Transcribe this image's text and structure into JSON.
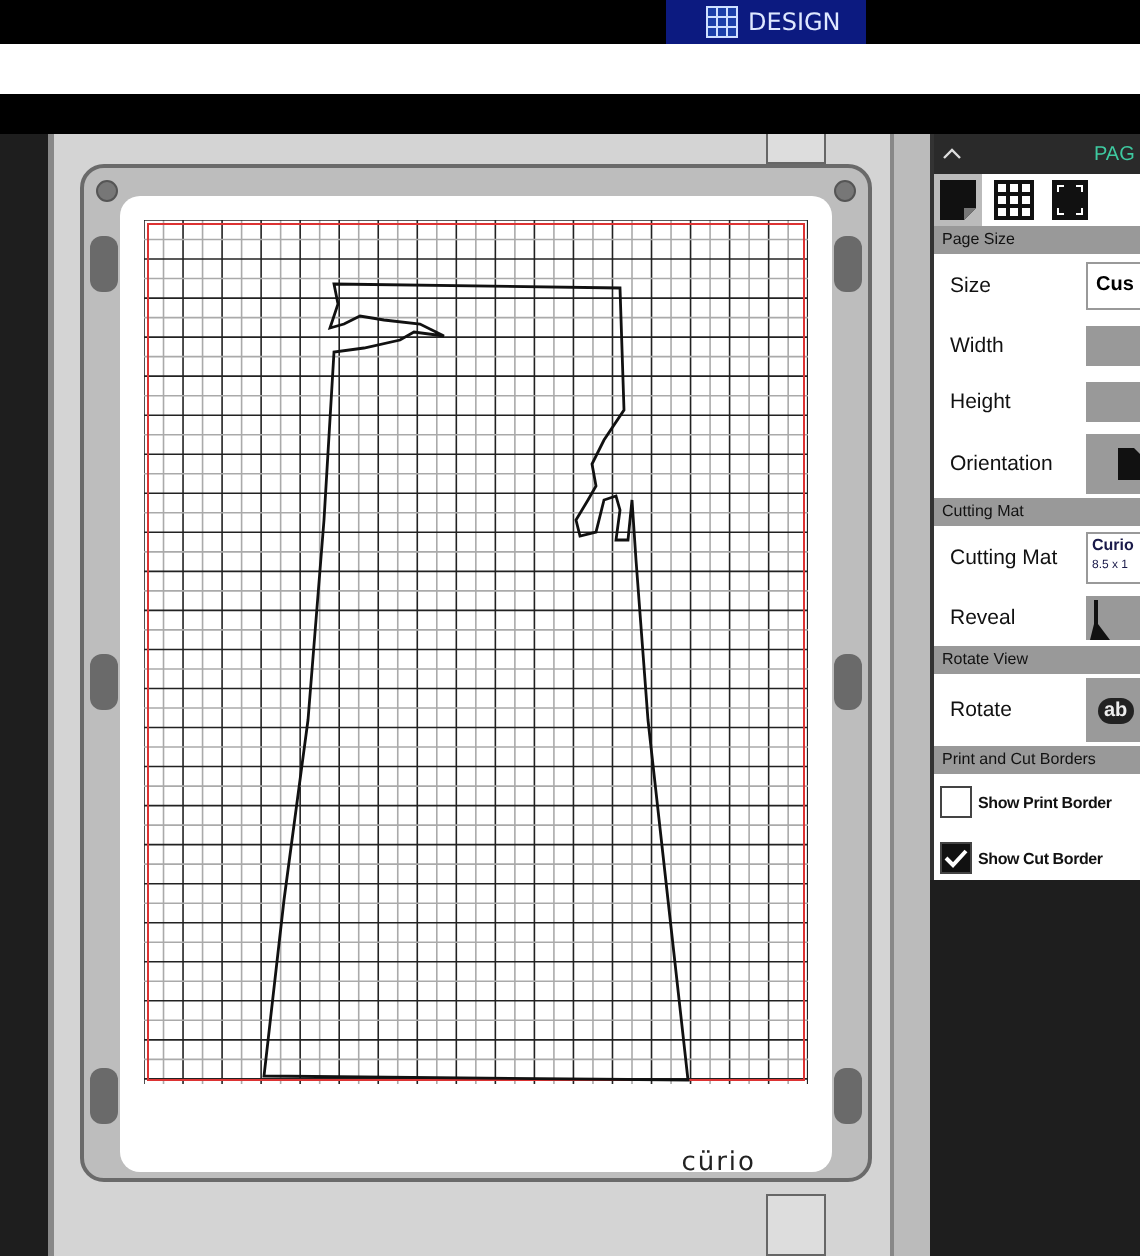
{
  "top_bar": {
    "tabs": [
      {
        "label": "DESIGN",
        "selected": true
      }
    ]
  },
  "canvas": {
    "mat": {
      "brand": "cürio"
    }
  },
  "panel": {
    "title": "PAG",
    "view_tabs": [
      {
        "kind": "page",
        "selected": true
      },
      {
        "kind": "grid",
        "selected": false
      },
      {
        "kind": "corners",
        "selected": false
      }
    ],
    "sections": [
      {
        "title": "Page Size",
        "rows": [
          {
            "kind": "select",
            "label": "Size",
            "value": "Cus"
          },
          {
            "kind": "input",
            "label": "Width"
          },
          {
            "kind": "input",
            "label": "Height"
          },
          {
            "kind": "orientation",
            "label": "Orientation"
          }
        ]
      },
      {
        "title": "Cutting Mat",
        "rows": [
          {
            "kind": "mat",
            "label": "Cutting Mat",
            "value": "Curio",
            "subvalue": "8.5 x 1"
          },
          {
            "kind": "reveal",
            "label": "Reveal"
          }
        ]
      },
      {
        "title": "Rotate View",
        "rows": [
          {
            "kind": "rotate",
            "label": "Rotate",
            "value": "ab"
          }
        ]
      },
      {
        "title": "Print and Cut Borders",
        "rows": [
          {
            "kind": "check",
            "label": "Show Print Border",
            "checked": false
          },
          {
            "kind": "check",
            "label": "Show Cut Border",
            "checked": true
          }
        ]
      }
    ]
  }
}
